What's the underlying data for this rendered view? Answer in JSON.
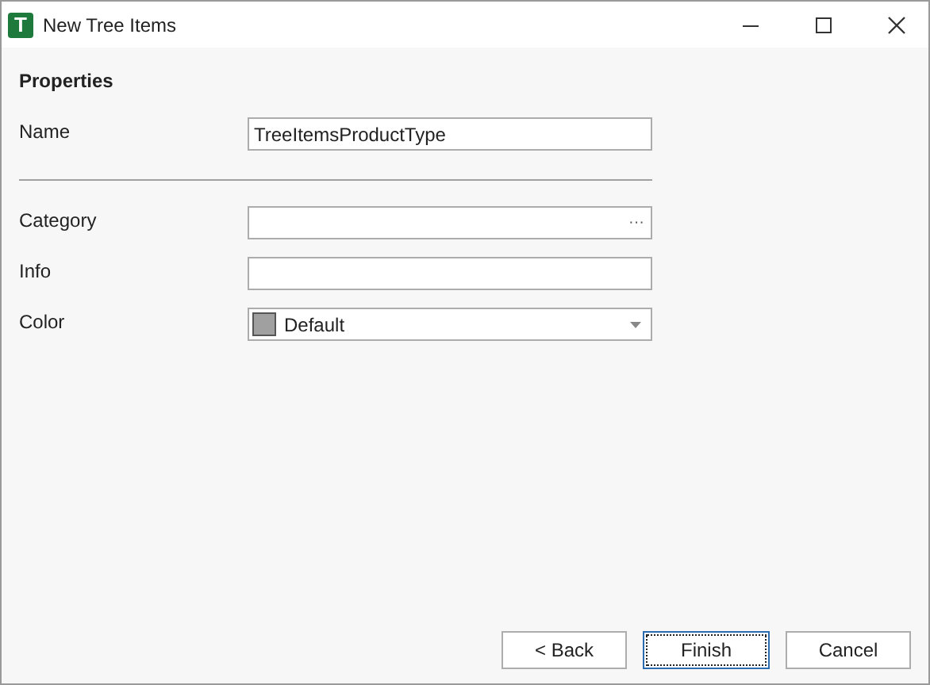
{
  "window": {
    "icon_letter": "T",
    "title": "New Tree Items"
  },
  "section": "Properties",
  "fields": [
    {
      "kind": "text",
      "label": "Name",
      "value": "TreeItemsProductType"
    },
    {
      "kind": "divider"
    },
    {
      "kind": "browse",
      "label": "Category",
      "button": "···"
    },
    {
      "kind": "text",
      "label": "Info"
    },
    {
      "kind": "dropdown",
      "label": "Color",
      "value": "Default"
    }
  ],
  "buttons": [
    {
      "label": "< Back",
      "default": false
    },
    {
      "label": "Finish",
      "default": true
    },
    {
      "label": "Cancel",
      "default": false
    }
  ]
}
